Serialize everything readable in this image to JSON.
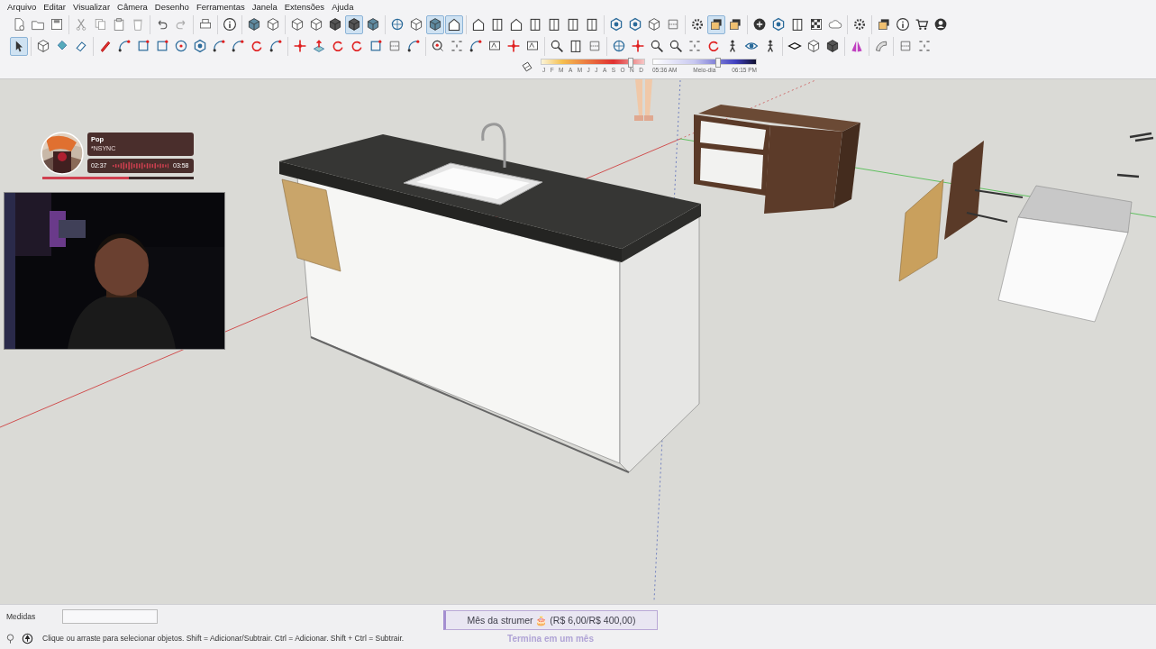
{
  "menu": [
    {
      "label": "Arquivo"
    },
    {
      "label": "Editar"
    },
    {
      "label": "Visualizar"
    },
    {
      "label": "Câmera"
    },
    {
      "label": "Desenho"
    },
    {
      "label": "Ferramentas"
    },
    {
      "label": "Janela"
    },
    {
      "label": "Extensões"
    },
    {
      "label": "Ajuda"
    }
  ],
  "toolbars": [
    {
      "groups": [
        [
          {
            "selected": false
          },
          {
            "selected": false
          },
          {
            "selected": false
          }
        ],
        [
          {
            "selected": false
          },
          {
            "selected": false
          },
          {
            "selected": false
          },
          {
            "selected": false
          }
        ],
        [
          {
            "selected": false
          },
          {
            "selected": false
          }
        ],
        [
          {
            "selected": false
          }
        ],
        [
          {
            "selected": false
          }
        ],
        [
          {
            "selected": false
          },
          {
            "selected": false
          }
        ],
        [
          {
            "selected": false
          },
          {
            "selected": false
          },
          {
            "selected": false
          },
          {
            "selected": true
          },
          {
            "selected": false
          }
        ],
        [
          {
            "selected": false
          },
          {
            "selected": false
          },
          {
            "selected": true
          },
          {
            "selected": true
          }
        ],
        [
          {
            "selected": false
          },
          {
            "selected": false
          },
          {
            "selected": false
          },
          {
            "selected": false
          },
          {
            "selected": false
          },
          {
            "selected": false
          },
          {
            "selected": false
          }
        ],
        [
          {
            "selected": false
          },
          {
            "selected": false
          },
          {
            "selected": false
          },
          {
            "selected": false
          }
        ],
        [
          {
            "selected": false
          },
          {
            "selected": true
          },
          {
            "selected": false
          }
        ],
        [
          {
            "selected": false
          },
          {
            "selected": false
          },
          {
            "selected": false
          },
          {
            "selected": false
          },
          {
            "selected": false
          }
        ],
        [
          {
            "selected": false
          }
        ],
        [
          {
            "selected": false
          },
          {
            "selected": false
          },
          {
            "selected": false
          },
          {
            "selected": false
          }
        ]
      ]
    },
    {
      "groups": [
        [
          {
            "selected": true
          }
        ],
        [
          {
            "selected": false
          },
          {
            "selected": false
          },
          {
            "selected": false
          }
        ],
        [
          {
            "selected": false
          },
          {
            "selected": false
          },
          {
            "selected": false
          },
          {
            "selected": false
          },
          {
            "selected": false
          },
          {
            "selected": false
          },
          {
            "selected": false
          },
          {
            "selected": false
          },
          {
            "selected": false
          },
          {
            "selected": false
          }
        ],
        [
          {
            "selected": false
          },
          {
            "selected": false
          },
          {
            "selected": false
          },
          {
            "selected": false
          },
          {
            "selected": false
          },
          {
            "selected": false
          },
          {
            "selected": false
          }
        ],
        [
          {
            "selected": false
          },
          {
            "selected": false
          },
          {
            "selected": false
          },
          {
            "selected": false
          },
          {
            "selected": false
          },
          {
            "selected": false
          }
        ],
        [
          {
            "selected": false
          },
          {
            "selected": false
          },
          {
            "selected": false
          }
        ],
        [
          {
            "selected": false
          },
          {
            "selected": false
          },
          {
            "selected": false
          },
          {
            "selected": false
          },
          {
            "selected": false
          },
          {
            "selected": false
          },
          {
            "selected": false
          },
          {
            "selected": false
          },
          {
            "selected": false
          }
        ],
        [
          {
            "selected": false
          },
          {
            "selected": false
          },
          {
            "selected": false
          }
        ],
        [
          {
            "selected": false
          }
        ],
        [
          {
            "selected": false
          }
        ],
        [
          {
            "selected": false
          },
          {
            "selected": false
          }
        ]
      ]
    }
  ],
  "shadows": {
    "months": [
      "J",
      "F",
      "M",
      "A",
      "M",
      "J",
      "J",
      "A",
      "S",
      "O",
      "N",
      "D"
    ],
    "month_slider": {
      "level": 0.86
    },
    "time_slider": {
      "level": 0.62
    },
    "time_start": "05:36 AM",
    "time_middle": "Meio-dia",
    "time_end": "06:15 PM"
  },
  "music_widget": {
    "genre": "Pop",
    "artist": "*NSYNC",
    "elapsed": "02:37",
    "duration": "03:58",
    "progress": {
      "level": 0.57
    }
  },
  "status_bar": {
    "measurements_label": "Medidas",
    "message": "Clique ou arraste para selecionar objetos. Shift = Adicionar/Subtrair. Ctrl = Adicionar. Shift + Ctrl = Subtrair."
  },
  "goal_overlay": {
    "title": "Mês da strumer 🎂 (R$ 6,00/R$ 400,00)",
    "subtitle": "Termina em um mês"
  }
}
